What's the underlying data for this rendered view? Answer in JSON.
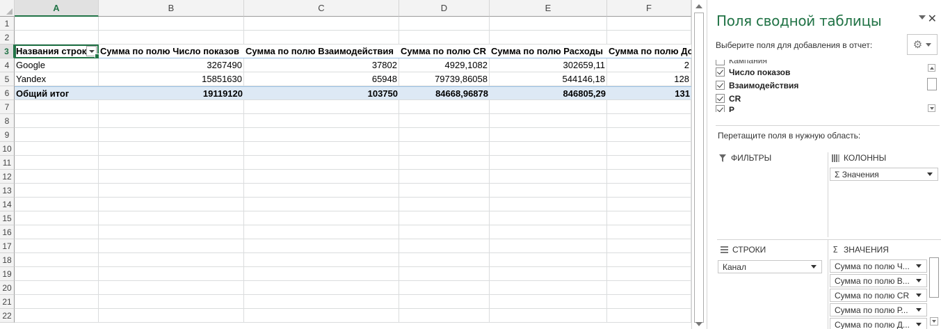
{
  "sheet": {
    "columns": [
      "A",
      "B",
      "C",
      "D",
      "E",
      "F"
    ],
    "rows": [
      "1",
      "2",
      "3",
      "4",
      "5",
      "6",
      "7",
      "8",
      "9",
      "10",
      "11",
      "12",
      "13",
      "14",
      "15",
      "16",
      "17",
      "18",
      "19",
      "20",
      "21",
      "22"
    ],
    "pivot": {
      "headers": [
        "Названия строк",
        "Сумма по полю Число показов",
        "Сумма по полю Взаимодействия",
        "Сумма по полю CR",
        "Сумма по полю Расходы",
        "Сумма по полю До"
      ],
      "body": [
        [
          "Google",
          "3267490",
          "37802",
          "4929,1082",
          "302659,11",
          "2"
        ],
        [
          "Yandex",
          "15851630",
          "65948",
          "79739,86058",
          "544146,18",
          "128"
        ]
      ],
      "total": [
        "Общий итог",
        "19119120",
        "103750",
        "84668,96878",
        "846805,29",
        "131"
      ]
    }
  },
  "pane": {
    "title": "Поля сводной таблицы",
    "close_glyph": "✕",
    "choose_label": "Выберите поля для добавления в отчет:",
    "gear_glyph": "⚙",
    "fields": [
      {
        "label": "Кампания",
        "checked": false
      },
      {
        "label": "Число показов",
        "checked": true
      },
      {
        "label": "Взаимодействия",
        "checked": true
      },
      {
        "label": "CR",
        "checked": true
      },
      {
        "label": "Р",
        "checked": true
      }
    ],
    "drag_label": "Перетащите поля в нужную область:",
    "areas": {
      "filters": {
        "title": "ФИЛЬТРЫ",
        "icon": "filter-icon"
      },
      "columns": {
        "title": "КОЛОННЫ",
        "icon": "columns-icon",
        "items": [
          "Σ  Значения"
        ]
      },
      "rows": {
        "title": "СТРОКИ",
        "icon": "rows-icon",
        "items": [
          "Канал"
        ]
      },
      "values": {
        "title": "ЗНАЧЕНИЯ",
        "icon": "sigma-icon",
        "items": [
          "Сумма по полю Ч...",
          "Сумма по полю В...",
          "Сумма по полю CR",
          "Сумма по полю Р...",
          "Сумма по полю Д..."
        ]
      }
    }
  },
  "colors": {
    "accent": "#217346",
    "total_row": "#dde9f5",
    "header_border": "#9bc2e6"
  }
}
